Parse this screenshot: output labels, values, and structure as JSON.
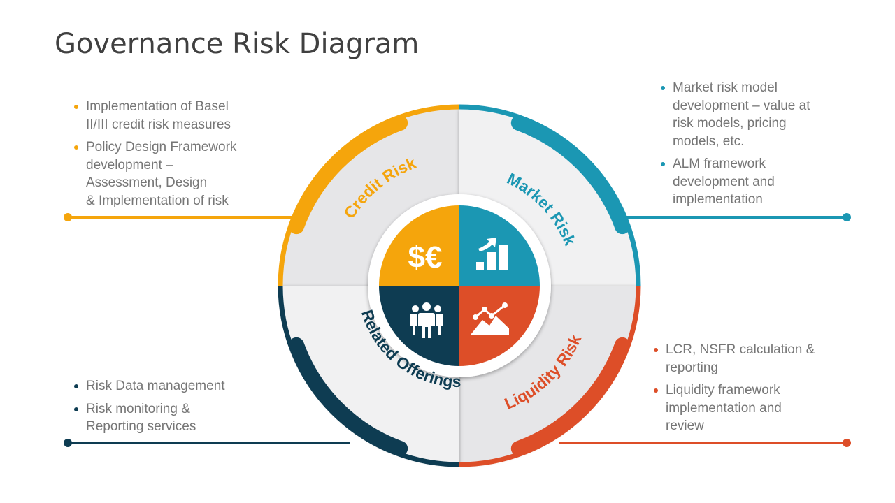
{
  "title": "Governance Risk Diagram",
  "colors": {
    "credit": "#F5A50C",
    "market": "#1B97B3",
    "related": "#0E3C52",
    "liquidity": "#DD4E28",
    "segment_bg": "#E9E9EB",
    "text": "#767676",
    "title": "#404040"
  },
  "segments": {
    "credit": {
      "label": "Credit Risk",
      "icon": "currency-dollar-euro-icon",
      "icon_text": "$€",
      "bullets": [
        "Implementation  of Basel II/III credit risk measures",
        "Policy Design Framework development  – Assessment, Design & Implementation  of risk"
      ],
      "bullet_lines": [
        [
          "Implementation  of Basel",
          "II/III credit risk measures"
        ],
        [
          "Policy Design Framework",
          "development  –",
          "Assessment, Design",
          "& Implementation  of risk"
        ]
      ]
    },
    "market": {
      "label": "Market Risk",
      "icon": "bar-chart-growth-icon",
      "bullet_lines": [
        [
          "Market risk model",
          "development  – value at",
          "risk models, pricing",
          "models, etc."
        ],
        [
          "ALM framework",
          "development and",
          "implementation"
        ]
      ]
    },
    "related": {
      "label": "Related Offerings",
      "icon": "team-people-icon",
      "bullet_lines": [
        [
          "Risk Data management"
        ],
        [
          "Risk monitoring  &",
          "Reporting services"
        ]
      ]
    },
    "liquidity": {
      "label": "Liquidity Risk",
      "icon": "line-chart-mountain-icon",
      "bullet_lines": [
        [
          "LCR, NSFR calculation &",
          "reporting"
        ],
        [
          "Liquidity framework",
          "implementation  and",
          "review"
        ]
      ]
    }
  }
}
